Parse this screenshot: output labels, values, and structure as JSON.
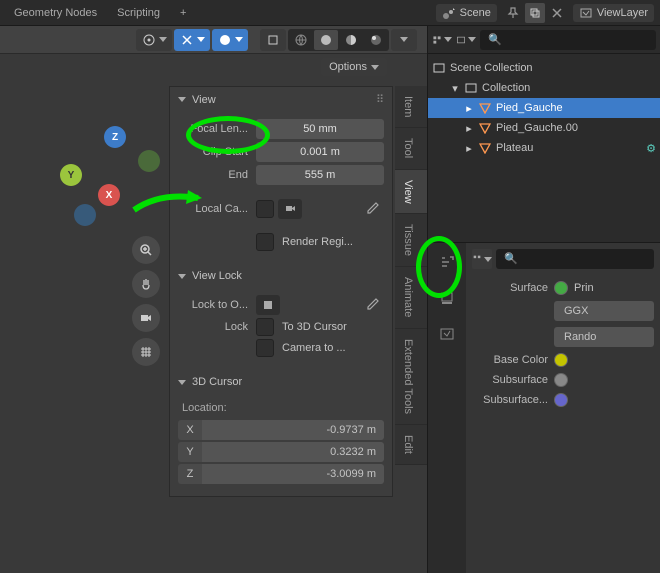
{
  "topbar": {
    "tab_geometry": "Geometry Nodes",
    "tab_scripting": "Scripting",
    "scene_label": "Scene",
    "viewlayer_label": "ViewLayer"
  },
  "options_label": "Options",
  "view_panel": {
    "title": "View",
    "focal_label": "Focal Len...",
    "focal_value": "50 mm",
    "clip_start_label": "Clip Start",
    "clip_start_value": "0.001 m",
    "end_label": "End",
    "end_value": "555 m",
    "local_cam_label": "Local Ca...",
    "render_region_label": "Render Regi..."
  },
  "view_lock": {
    "title": "View Lock",
    "lock_to_label": "Lock to O...",
    "lock_label": "Lock",
    "to_3d_cursor": "To 3D Cursor",
    "camera_to": "Camera to ..."
  },
  "cursor": {
    "title": "3D Cursor",
    "location_label": "Location:",
    "x_label": "X",
    "x_value": "-0.9737 m",
    "y_label": "Y",
    "y_value": "0.3232 m",
    "z_label": "Z",
    "z_value": "-3.0099 m"
  },
  "side_tabs": [
    "Item",
    "Tool",
    "View",
    "Tissue",
    "Animate",
    "Extended Tools",
    "Edit"
  ],
  "outliner": {
    "root": "Scene Collection",
    "collection": "Collection",
    "items": [
      "Pied_Gauche",
      "Pied_Gauche.00",
      "Plateau"
    ]
  },
  "props": {
    "surface_label": "Surface",
    "surface_value": "Prin",
    "shader_model": "GGX",
    "subsurface_model": "Rando",
    "base_color_label": "Base Color",
    "subsurface_label": "Subsurface",
    "subsurface_color_label": "Subsurface...",
    "base_color": "#c4c400",
    "subsurface_color": "#888888",
    "subsurface_rgb": "#6666cc"
  },
  "gizmo": {
    "x": "X",
    "y": "Y",
    "z": "Z"
  }
}
